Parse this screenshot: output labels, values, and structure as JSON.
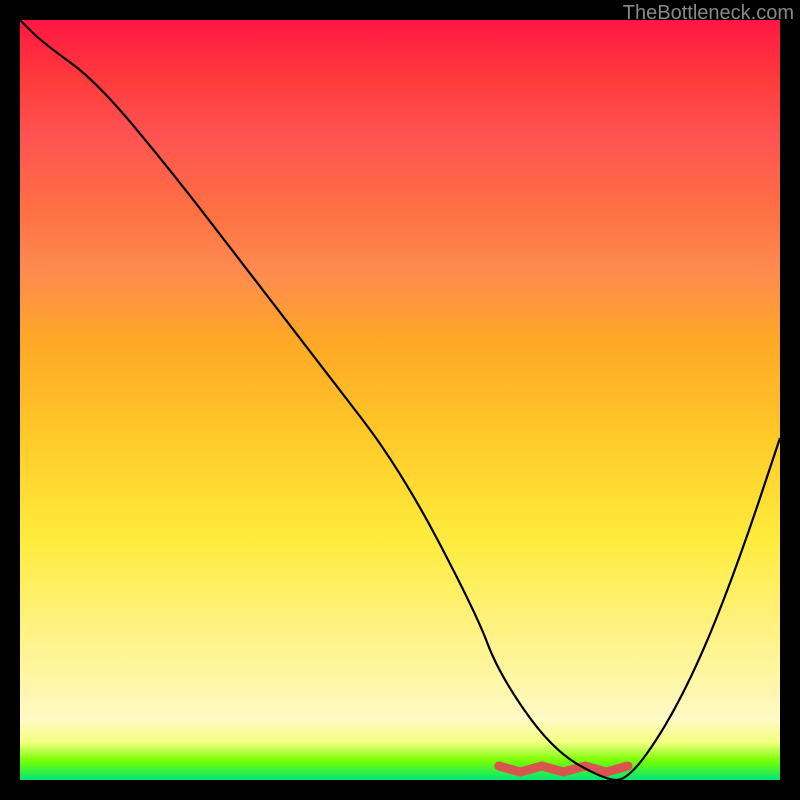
{
  "watermark": "TheBottleneck.com",
  "chart_data": {
    "type": "line",
    "title": "",
    "xlabel": "",
    "ylabel": "",
    "xlim": [
      0,
      100
    ],
    "ylim": [
      0,
      100
    ],
    "grid": false,
    "series": [
      {
        "name": "curve",
        "x": [
          0,
          3,
          10,
          20,
          30,
          40,
          50,
          60,
          63,
          70,
          77,
          80,
          85,
          90,
          95,
          100
        ],
        "values": [
          100,
          97,
          92,
          80,
          67,
          54,
          41,
          22,
          14,
          4,
          0,
          0,
          7,
          17,
          30,
          45
        ]
      }
    ],
    "trough": {
      "x_start": 63,
      "x_end": 80
    },
    "colors": {
      "background_top": "#ff1744",
      "background_bottom": "#00e676",
      "curve": "#000000",
      "trough_marker": "#d9534f"
    }
  }
}
